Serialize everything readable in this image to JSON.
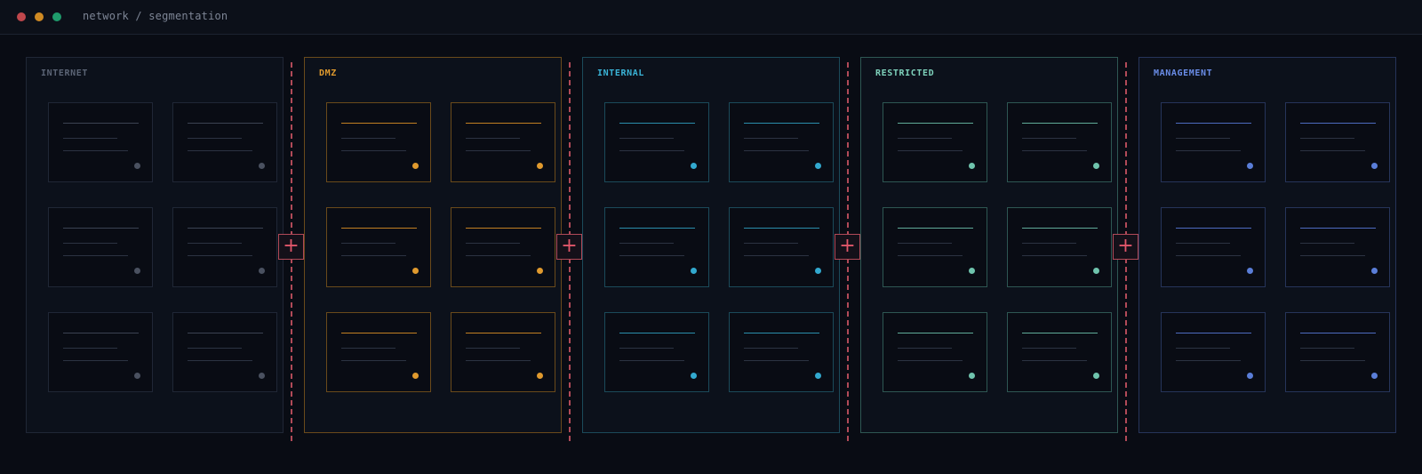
{
  "window": {
    "title": "network / segmentation",
    "controls": [
      {
        "name": "close",
        "color": "#c0474c"
      },
      {
        "name": "minimize",
        "color": "#cf8a23"
      },
      {
        "name": "maximize",
        "color": "#1f9c6c"
      }
    ]
  },
  "zones": [
    {
      "id": "internet",
      "label": "INTERNET",
      "color": "#5b6475",
      "border": "#202736",
      "line": "#3b4352",
      "status": "#4a5160"
    },
    {
      "id": "dmz",
      "label": "DMZ",
      "color": "#e09a2e",
      "border": "#6a4a1b",
      "line": "#c17f22",
      "status": "#e09a2e"
    },
    {
      "id": "internal",
      "label": "INTERNAL",
      "color": "#3ab3d6",
      "border": "#1b4a5a",
      "line": "#2a8eac",
      "status": "#32a9cf"
    },
    {
      "id": "restricted",
      "label": "RESTRICTED",
      "color": "#7ed1bb",
      "border": "#2e5753",
      "line": "#5fab98",
      "status": "#6fc4ad"
    },
    {
      "id": "management",
      "label": "MANAGEMENT",
      "color": "#6a8de8",
      "border": "#26345a",
      "line": "#4d6bc0",
      "status": "#5a7ed8"
    }
  ],
  "firewalls": {
    "color": "#e0566a",
    "glyph": "+",
    "count": 4
  },
  "hosts_per_zone": 6
}
